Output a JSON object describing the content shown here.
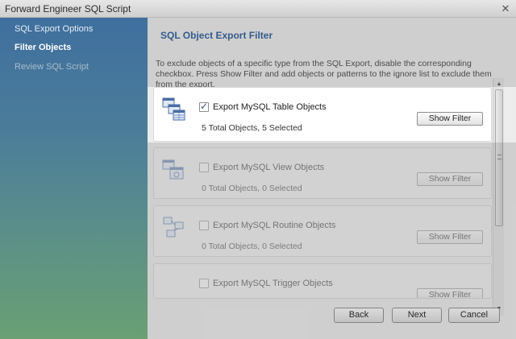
{
  "window": {
    "title": "Forward Engineer SQL Script",
    "close_glyph": "✕"
  },
  "sidebar": {
    "items": [
      {
        "label": "SQL Export Options"
      },
      {
        "label": "Filter Objects"
      },
      {
        "label": "Review SQL Script"
      }
    ]
  },
  "main": {
    "heading": "SQL Object Export Filter",
    "description": "To exclude objects of a specific type from the SQL Export, disable the corresponding checkbox. Press Show Filter and add objects or patterns to the ignore list to exclude them from the export."
  },
  "panels": [
    {
      "label": "Export MySQL Table Objects",
      "count": "5 Total Objects, 5 Selected",
      "checked": true,
      "button": "Show Filter",
      "icon": "table-objects-icon"
    },
    {
      "label": "Export MySQL View Objects",
      "count": "0 Total Objects, 0 Selected",
      "checked": false,
      "button": "Show Filter",
      "icon": "view-objects-icon"
    },
    {
      "label": "Export MySQL Routine Objects",
      "count": "0 Total Objects, 0 Selected",
      "checked": false,
      "button": "Show Filter",
      "icon": "routine-objects-icon"
    },
    {
      "label": "Export MySQL Trigger Objects",
      "count": "",
      "checked": false,
      "button": "Show Filter",
      "icon": "trigger-objects-icon"
    }
  ],
  "buttons": {
    "back": "Back",
    "next": "Next",
    "cancel": "Cancel"
  },
  "colors": {
    "heading": "#2f5e9a",
    "sidebar_top": "#3f6f9e",
    "sidebar_bottom": "#6aa074"
  }
}
